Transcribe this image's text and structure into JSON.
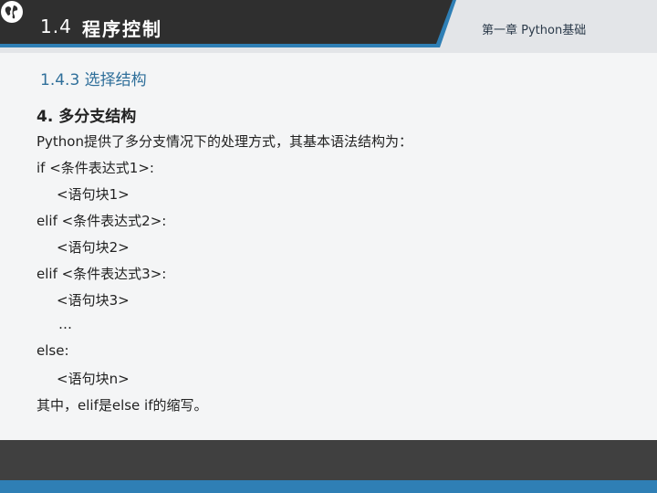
{
  "header": {
    "section_number": "1.4",
    "section_title": "程序控制",
    "chapter": "第一章 Python基础",
    "colors": {
      "dark_band": "#2f2f2f",
      "blue_accent": "#2f7fb5",
      "light_band": "#e3e5e8"
    },
    "logo_icon": "globe-icon"
  },
  "content": {
    "subheading": "1.4.3  选择结构",
    "topic": "4. 多分支结构",
    "lines": [
      "Python提供了多分支情况下的处理方式，其基本语法结构为：",
      "if <条件表达式1>:",
      "<语句块1>",
      "elif <条件表达式2>:",
      "<语句块2>",
      "elif <条件表达式3>:",
      "<语句块3>",
      "…",
      "else:",
      "<语句块n>",
      "其中，elif是else if的缩写。"
    ]
  },
  "footer": {
    "colors": {
      "dark": "#404040",
      "blue": "#2f7fb5"
    }
  }
}
